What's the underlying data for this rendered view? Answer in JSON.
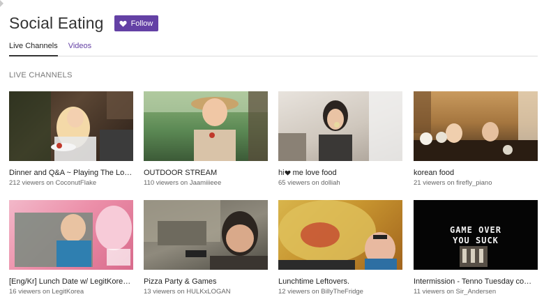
{
  "page": {
    "title": "Social Eating",
    "follow_label": "Follow"
  },
  "tabs": [
    {
      "label": "Live Channels",
      "active": true
    },
    {
      "label": "Videos",
      "active": false
    }
  ],
  "section": {
    "label": "LIVE CHANNELS"
  },
  "colors": {
    "accent": "#6441a5",
    "title": "#333333",
    "meta": "#666666"
  },
  "channels": [
    {
      "title": "Dinner and Q&A ~ Playing The Lo…",
      "meta": "212 viewers on CoconutFlake"
    },
    {
      "title": "OUTDOOR STREAM",
      "meta": "110 viewers on Jaamiiieee"
    },
    {
      "title_before": "hi",
      "title_after": " me love food",
      "icon": "heart-icon",
      "meta": "65 viewers on dolliah"
    },
    {
      "title": "korean food",
      "meta": "21 viewers on firefly_piano"
    },
    {
      "title": "[Eng/Kr] Lunch Date w/ LegitKorea…",
      "meta": "16 viewers on LegitKorea"
    },
    {
      "title": "Pizza Party & Games",
      "meta": "13 viewers on HULKxLOGAN"
    },
    {
      "title": "Lunchtime Leftovers.",
      "meta": "12 viewers on BillyTheFridge"
    },
    {
      "title": "Intermission - Tenno Tuesday com…",
      "meta": "11 viewers on Sir_Andersen"
    }
  ],
  "thumb_text": {
    "game_over_line1": "GAME OVER",
    "game_over_line2": "YOU SUCK"
  }
}
